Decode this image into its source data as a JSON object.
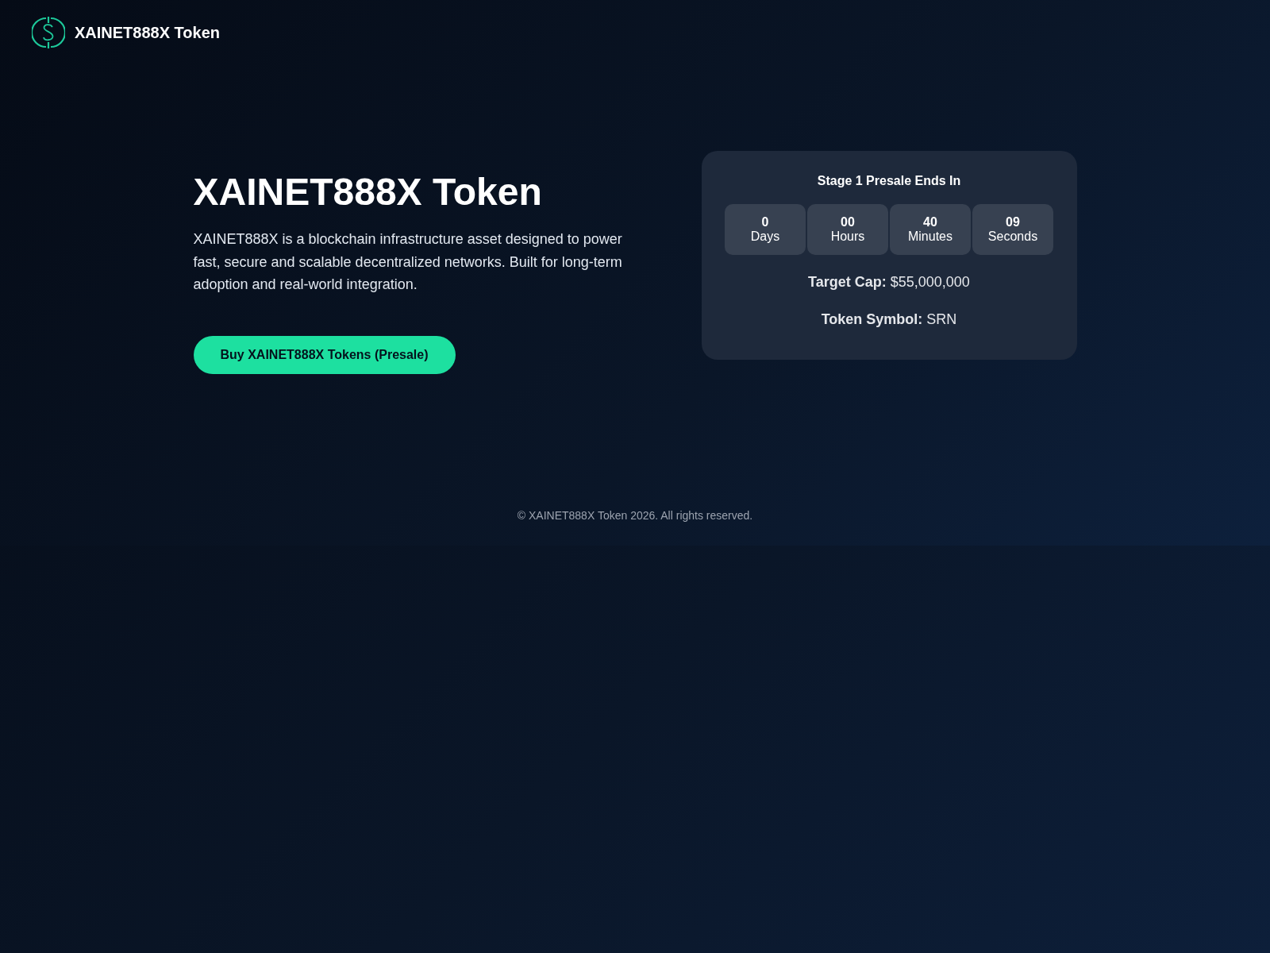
{
  "header": {
    "brand": "XAINET888X Token"
  },
  "hero": {
    "title": "XAINET888X Token",
    "description": "XAINET888X is a blockchain infrastructure asset designed to power fast, secure and scalable decentralized networks. Built for long-term adoption and real-world integration.",
    "button": "Buy XAINET888X Tokens (Presale)"
  },
  "presale": {
    "title": "Stage 1 Presale Ends In",
    "countdown": [
      {
        "value": "0",
        "unit": "Days"
      },
      {
        "value": "00",
        "unit": "Hours"
      },
      {
        "value": "40",
        "unit": "Minutes"
      },
      {
        "value": "09",
        "unit": "Seconds"
      }
    ],
    "facts": [
      "**Target Cap:** $55,000,000",
      "**Token Symbol:** SRN"
    ]
  },
  "footer": {
    "text": "© XAINET888X Token 2026. All rights reserved."
  }
}
